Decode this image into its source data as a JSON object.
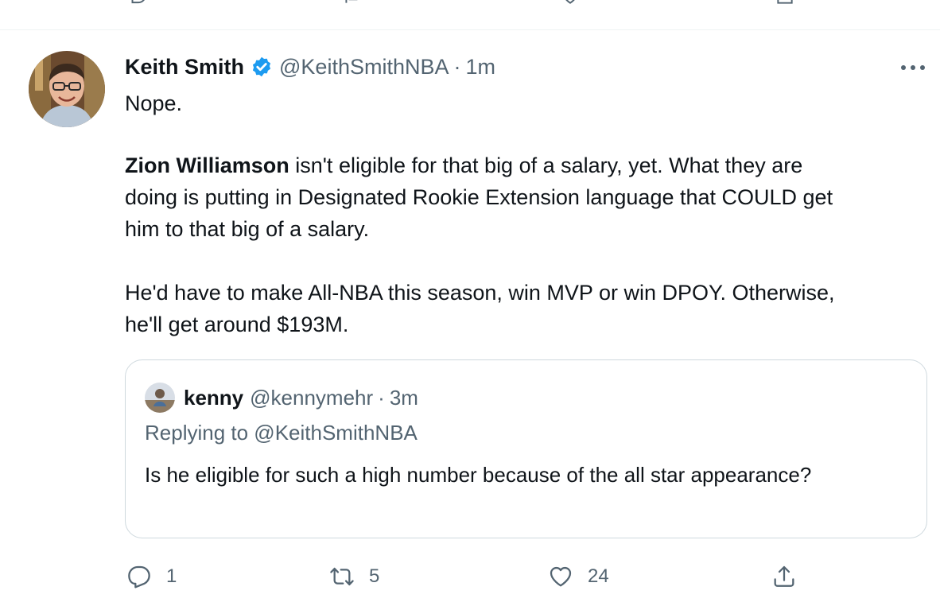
{
  "tweet": {
    "author": {
      "name": "Keith Smith",
      "handle": "@KeithSmithNBA",
      "separator": "·",
      "time": "1m",
      "verified": true
    },
    "lines": [
      [
        {
          "text": "Nope.",
          "bold": false
        }
      ],
      [
        {
          "text": "Zion Williamson",
          "bold": true
        },
        {
          "text": " isn't eligible for that big of a salary, yet. What they are",
          "bold": false
        }
      ],
      [
        {
          "text": "doing is putting in Designated Rookie Extension language that COULD get",
          "bold": false
        }
      ],
      [
        {
          "text": "him to that big of a salary.",
          "bold": false
        }
      ],
      [
        {
          "text": "He'd have to make All-NBA this season, win MVP or win DPOY. Otherwise,",
          "bold": false
        }
      ],
      [
        {
          "text": "he'll get around $193M.",
          "bold": false
        }
      ]
    ],
    "quoted": {
      "name": "kenny",
      "handle": "@kennymehr",
      "separator": "·",
      "time": "3m",
      "replying_to": "Replying to @KeithSmithNBA",
      "text": "Is he eligible for such a high number because of the all star appearance?"
    },
    "actions": {
      "reply_count": "1",
      "retweet_count": "5",
      "like_count": "24"
    }
  },
  "icons": {
    "verified": "verified-badge-icon",
    "more": "more-options-icon",
    "reply": "reply-icon",
    "retweet": "retweet-icon",
    "like": "like-heart-icon",
    "share": "share-icon"
  },
  "colors": {
    "text_primary": "#0f1419",
    "text_secondary": "#536471",
    "verified_blue": "#1d9bf0",
    "border": "#cfd9de"
  }
}
